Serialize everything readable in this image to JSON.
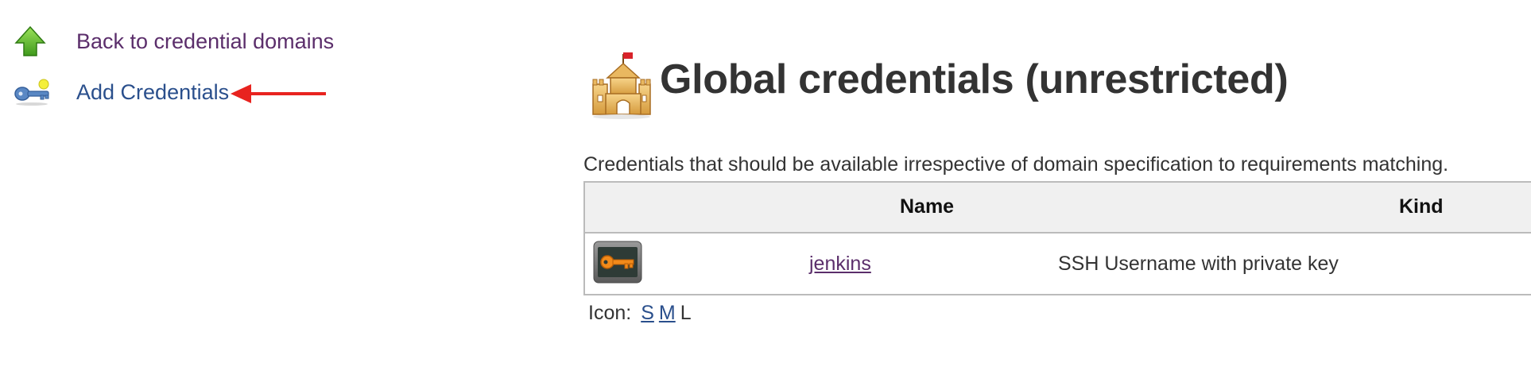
{
  "sidebar": {
    "items": [
      {
        "label": "Back to credential domains",
        "icon": "green-up-arrow-icon"
      },
      {
        "label": "Add Credentials",
        "icon": "key-icon"
      }
    ]
  },
  "header": {
    "title": "Global credentials (unrestricted)",
    "icon": "castle-icon"
  },
  "description": "Credentials that should be available irrespective of domain specification to requirements matching.",
  "table": {
    "columns": [
      "Name",
      "Kind"
    ],
    "rows": [
      {
        "icon": "credential-key-icon",
        "name": "jenkins",
        "kind": "SSH Username with private key"
      }
    ]
  },
  "icon_size": {
    "label": "Icon:",
    "options": [
      "S",
      "M",
      "L"
    ],
    "selected": "L"
  },
  "colors": {
    "visited_link": "#5b2e6b",
    "link": "#2a4f8c",
    "annotation_arrow": "#e8231f",
    "table_header_bg": "#f0f0f0"
  }
}
